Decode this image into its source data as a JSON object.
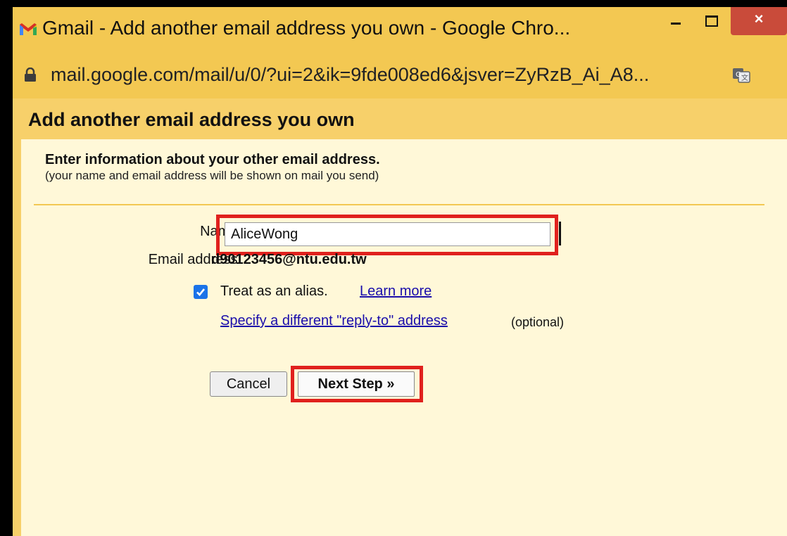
{
  "window": {
    "title": "Gmail - Add another email address you own - Google Chro...",
    "close_glyph": "×",
    "icons": [
      "gmail-logo",
      "minimize",
      "maximize",
      "close"
    ]
  },
  "addressbar": {
    "url": "mail.google.com/mail/u/0/?ui=2&ik=9fde008ed6&jsver=ZyRzB_Ai_A8...",
    "icons": [
      "lock-icon",
      "translate-icon"
    ]
  },
  "page": {
    "title": "Add another email address you own",
    "heading": "Enter information about your other email address.",
    "subheading": "(your name and email address will be shown on mail you send)"
  },
  "form": {
    "name_label": "Name:",
    "name_value": "AliceWong",
    "email_label": "Email address:",
    "email_value": "d90123456@ntu.edu.tw",
    "alias_checked": true,
    "alias_text": "Treat as an alias.",
    "learn_more_link": "Learn more",
    "reply_to_link": "Specify a different \"reply-to\" address",
    "optional_text": "(optional)"
  },
  "buttons": {
    "cancel_label": "Cancel",
    "next_label": "Next Step »"
  },
  "colors": {
    "chrome_yellow": "#f3c852",
    "panel_background": "#fff8d8",
    "highlight_red": "#e0211d",
    "checkbox_blue": "#1a73e8",
    "link_blue": "#1a0dab"
  }
}
